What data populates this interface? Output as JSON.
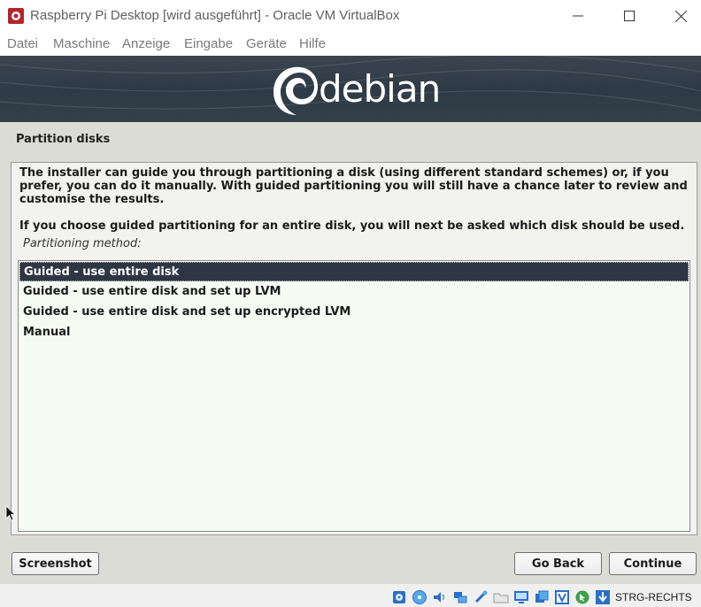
{
  "window": {
    "title": "Raspberry Pi Desktop [wird ausgeführt] - Oracle VM VirtualBox"
  },
  "menu": {
    "items": [
      "Datei",
      "Maschine",
      "Anzeige",
      "Eingabe",
      "Geräte",
      "Hilfe"
    ]
  },
  "installer": {
    "logo_text": "debian",
    "page_title": "Partition disks",
    "description": "The installer can guide you through partitioning a disk (using different standard schemes) or, if you prefer, you can do it manually. With guided partitioning you will still have a chance later to review and customise the results.",
    "description2": "If you choose guided partitioning for an entire disk, you will next be asked which disk should be used.",
    "method_label": "Partitioning method:",
    "options": [
      "Guided - use entire disk",
      "Guided - use entire disk and set up LVM",
      "Guided - use entire disk and set up encrypted LVM",
      "Manual"
    ],
    "selected_option": "Guided - use entire disk",
    "buttons": {
      "screenshot": "Screenshot",
      "go_back": "Go Back",
      "continue": "Continue"
    }
  },
  "statusbar": {
    "host_key": "STRG-RECHTS",
    "icons": [
      "hard-disk-icon",
      "optical-drive-icon",
      "audio-icon",
      "network-icon",
      "usb-icon",
      "shared-folders-icon",
      "display-icon",
      "video-capture-icon",
      "virtualization-icon",
      "mouse-integration-icon",
      "keyboard-capture-icon"
    ]
  },
  "colors": {
    "banner": "#2e3a45",
    "selection": "#2f3643",
    "list_background": "#f5fbf3",
    "vm_background": "#dcdcd6"
  }
}
